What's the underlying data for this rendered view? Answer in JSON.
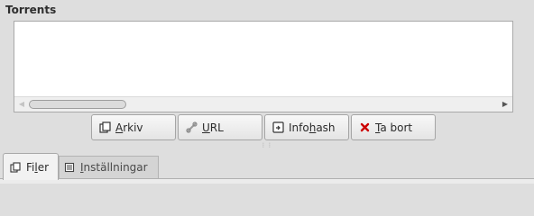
{
  "section": {
    "title": "Torrents"
  },
  "buttons": {
    "arkiv": {
      "prefix": "",
      "mnemonic": "A",
      "rest": "rkiv",
      "icon": "file-icon"
    },
    "url": {
      "prefix": "",
      "mnemonic": "U",
      "rest": "RL",
      "icon": "link-icon"
    },
    "infohash": {
      "prefix": "Info",
      "mnemonic": "h",
      "rest": "ash",
      "icon": "infohash-icon"
    },
    "remove": {
      "prefix": "",
      "mnemonic": "T",
      "rest": "a bort",
      "icon": "remove-icon",
      "icon_color": "#cc0000"
    }
  },
  "tabs": [
    {
      "prefix": "Fi",
      "mnemonic": "l",
      "rest": "er",
      "icon": "files-icon",
      "active": true
    },
    {
      "prefix": "",
      "mnemonic": "I",
      "rest": "nställningar",
      "icon": "settings-icon",
      "active": false
    }
  ]
}
